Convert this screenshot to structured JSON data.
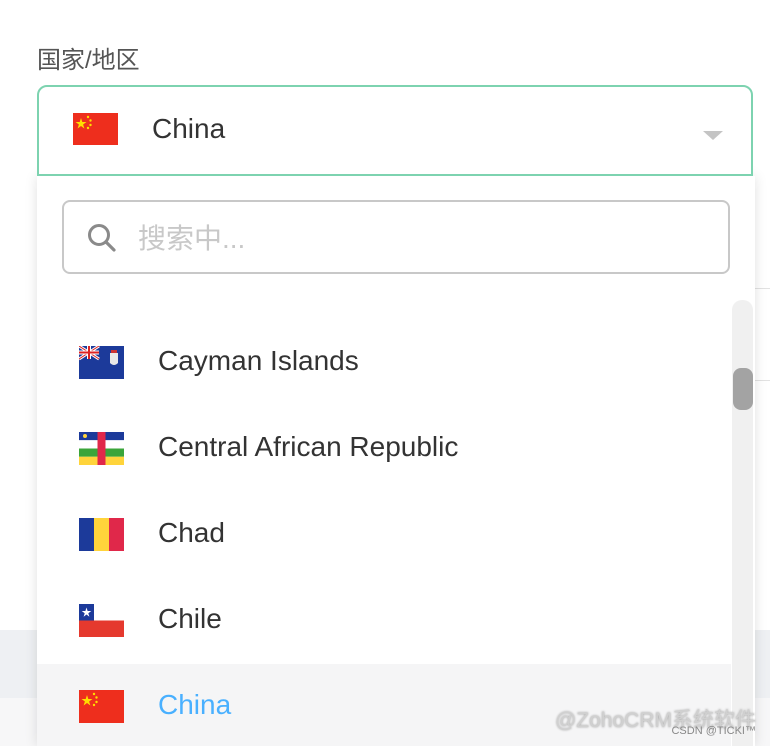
{
  "field": {
    "label": "国家/地区",
    "selected_value": "China",
    "selected_flag": "flag-china"
  },
  "search": {
    "placeholder": "搜索中...",
    "value": "",
    "icon": "search-icon"
  },
  "options": [
    {
      "label": "Cayman Islands",
      "flag": "flag-cayman-islands",
      "selected": false
    },
    {
      "label": "Central African Republic",
      "flag": "flag-central-african-republic",
      "selected": false
    },
    {
      "label": "Chad",
      "flag": "flag-chad",
      "selected": false
    },
    {
      "label": "Chile",
      "flag": "flag-chile",
      "selected": false
    },
    {
      "label": "China",
      "flag": "flag-china",
      "selected": true
    }
  ],
  "scrollbar": {
    "position_fraction": 0.16
  },
  "colors": {
    "focus_border": "#7dd3b0",
    "selected_text": "#49b0ff",
    "text": "#333333"
  },
  "watermark": {
    "primary": "@ZohoCRM系统软件",
    "secondary": "CSDN @TICKI™"
  }
}
